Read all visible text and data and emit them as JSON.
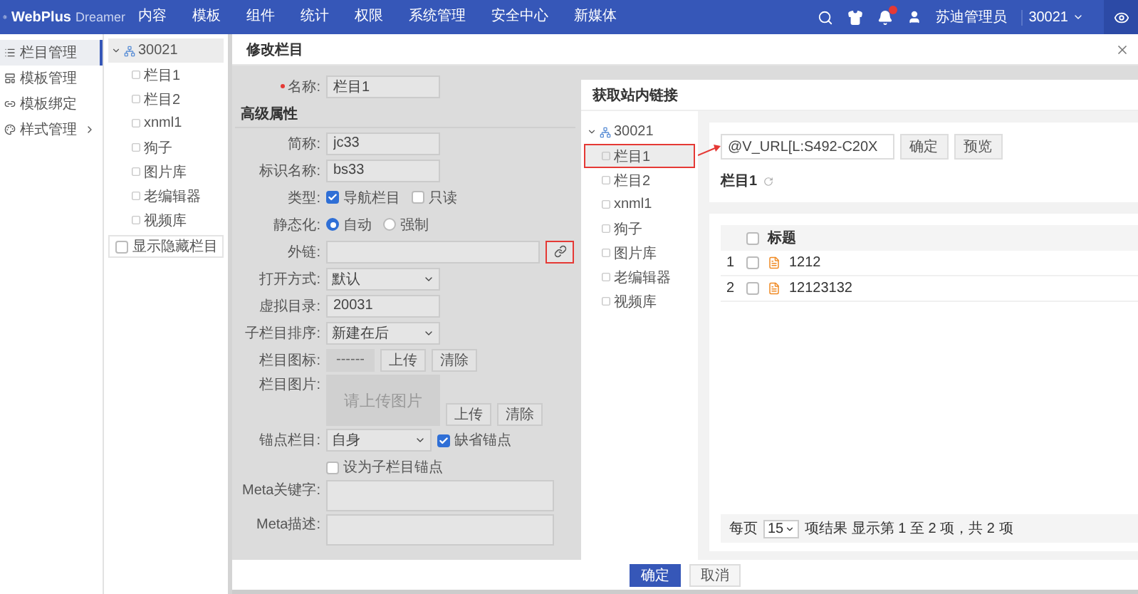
{
  "header": {
    "logo": {
      "brand": "WebPlus",
      "product": "Dreamer"
    },
    "nav": [
      {
        "label": "内容",
        "selected": false
      },
      {
        "label": "模板",
        "selected": false
      },
      {
        "label": "组件",
        "selected": false
      },
      {
        "label": "统计",
        "selected": false
      },
      {
        "label": "权限",
        "selected": false
      },
      {
        "label": "系统管理",
        "selected": false
      },
      {
        "label": "安全中心",
        "selected": false
      },
      {
        "label": "新媒体",
        "selected": false
      }
    ],
    "user": "苏迪管理员",
    "site": "30021"
  },
  "sidebar": {
    "items": [
      {
        "label": "栏目管理",
        "selected": true,
        "has_submenu": false
      },
      {
        "label": "模板管理",
        "selected": false,
        "has_submenu": false
      },
      {
        "label": "模板绑定",
        "selected": false,
        "has_submenu": false
      },
      {
        "label": "样式管理",
        "selected": false,
        "has_submenu": true
      }
    ]
  },
  "tree": {
    "root": "30021",
    "expanded": true,
    "children": [
      {
        "label": "栏目1"
      },
      {
        "label": "栏目2"
      },
      {
        "label": "xnml1"
      },
      {
        "label": "狗子"
      },
      {
        "label": "图片库"
      },
      {
        "label": "老编辑器"
      },
      {
        "label": "视频库"
      }
    ],
    "show_hidden": {
      "label": "显示隐藏栏目",
      "checked": false
    }
  },
  "dialog": {
    "title": "修改栏目",
    "form": {
      "fields": [
        {
          "kind": "text",
          "label": "名称:",
          "required": true,
          "value": "栏目1"
        },
        {
          "kind": "heading",
          "label": "高级属性"
        },
        {
          "kind": "text",
          "label": "简称:",
          "required": false,
          "value": "jc33"
        },
        {
          "kind": "text",
          "label": "标识名称:",
          "required": false,
          "value": "bs33"
        },
        {
          "kind": "checks",
          "label": "类型:",
          "options": [
            {
              "label": "导航栏目",
              "checked": true
            },
            {
              "label": "只读",
              "checked": false
            }
          ]
        },
        {
          "kind": "radios",
          "label": "静态化:",
          "options": [
            {
              "label": "自动",
              "selected": true
            },
            {
              "label": "强制",
              "selected": false
            }
          ]
        },
        {
          "kind": "link",
          "label": "外链:",
          "highlighted": true
        },
        {
          "kind": "select",
          "label": "打开方式:",
          "value": "默认"
        },
        {
          "kind": "text",
          "label": "虚拟目录:",
          "required": false,
          "value": "20031"
        },
        {
          "kind": "select",
          "label": "子栏目排序:",
          "value": "新建在后"
        },
        {
          "kind": "icon_upload",
          "label": "栏目图标:",
          "preview": "------",
          "buttons": [
            "上传",
            "清除"
          ]
        },
        {
          "kind": "image_upload",
          "label": "栏目图片:",
          "placeholder": "请上传图片",
          "buttons": [
            "上传",
            "清除"
          ]
        },
        {
          "kind": "anchor",
          "label": "锚点栏目:",
          "value": "自身",
          "options": [
            {
              "label": "缺省锚点",
              "checked": true
            },
            {
              "label": "设为子栏目锚点",
              "checked": false
            }
          ]
        },
        {
          "kind": "textarea",
          "label": "Meta关键字:"
        },
        {
          "kind": "textarea",
          "label": "Meta描述:"
        }
      ]
    },
    "footer": {
      "buttons": [
        {
          "label": "确定",
          "kind": "primary"
        },
        {
          "label": "取消",
          "kind": "default"
        }
      ]
    }
  },
  "link_picker": {
    "title": "获取站内链接",
    "tree": {
      "root": "30021",
      "expanded": true,
      "children": [
        {
          "label": "栏目1",
          "selected": true,
          "annotated": true
        },
        {
          "label": "栏目2",
          "selected": false,
          "annotated": false
        },
        {
          "label": "xnml1",
          "selected": false,
          "annotated": false
        },
        {
          "label": "狗子",
          "selected": false,
          "annotated": false
        },
        {
          "label": "图片库",
          "selected": false,
          "annotated": false
        },
        {
          "label": "老编辑器",
          "selected": false,
          "annotated": false
        },
        {
          "label": "视频库",
          "selected": false,
          "annotated": false
        }
      ]
    },
    "link_value": "@V_URL[L:S492-C20X",
    "buttons": [
      "确定",
      "预览"
    ],
    "current": "栏目1",
    "table": {
      "header_checked": false,
      "columns": [
        "标题"
      ],
      "rows": [
        {
          "index": "1",
          "title": "1212",
          "checked": false
        },
        {
          "index": "2",
          "title": "12123132",
          "checked": false
        }
      ]
    },
    "pagination": {
      "per_page_label": "每页",
      "per_page": "15",
      "summary": "项结果 显示第 1 至 2 项，共 2 项"
    }
  }
}
